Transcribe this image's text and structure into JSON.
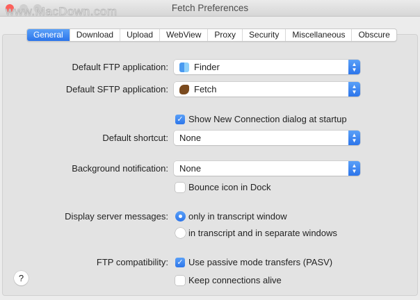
{
  "window": {
    "title": "Fetch Preferences",
    "watermark": "www.MacDown.com"
  },
  "tabs": [
    {
      "label": "General",
      "active": true
    },
    {
      "label": "Download"
    },
    {
      "label": "Upload"
    },
    {
      "label": "WebView"
    },
    {
      "label": "Proxy"
    },
    {
      "label": "Security"
    },
    {
      "label": "Miscellaneous"
    },
    {
      "label": "Obscure"
    }
  ],
  "general": {
    "ftp_app_label": "Default FTP application:",
    "ftp_app_value": "Finder",
    "sftp_app_label": "Default SFTP application:",
    "sftp_app_value": "Fetch",
    "show_new_connection": {
      "label": "Show New Connection dialog at startup",
      "checked": true
    },
    "shortcut_label": "Default shortcut:",
    "shortcut_value": "None",
    "bg_notification_label": "Background notification:",
    "bg_notification_value": "None",
    "bounce_icon": {
      "label": "Bounce icon in Dock",
      "checked": false
    },
    "server_messages_label": "Display server messages:",
    "server_messages_options": [
      {
        "label": "only in transcript window",
        "selected": true
      },
      {
        "label": "in transcript and in separate windows",
        "selected": false
      }
    ],
    "ftp_compat_label": "FTP compatibility:",
    "passive_mode": {
      "label": "Use passive mode transfers (PASV)",
      "checked": true
    },
    "keep_alive": {
      "label": "Keep connections alive",
      "checked": false
    }
  },
  "help_label": "?",
  "colors": {
    "accent": "#2c75ea"
  }
}
